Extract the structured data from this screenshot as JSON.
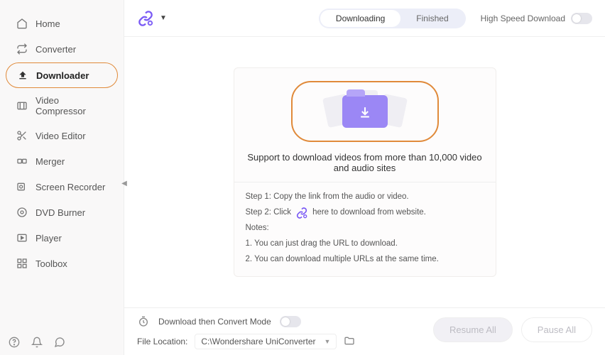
{
  "sidebar": {
    "items": [
      {
        "label": "Home"
      },
      {
        "label": "Converter"
      },
      {
        "label": "Downloader",
        "active": true
      },
      {
        "label": "Video Compressor"
      },
      {
        "label": "Video Editor"
      },
      {
        "label": "Merger"
      },
      {
        "label": "Screen Recorder"
      },
      {
        "label": "DVD Burner"
      },
      {
        "label": "Player"
      },
      {
        "label": "Toolbox"
      }
    ]
  },
  "topbar": {
    "tab_downloading": "Downloading",
    "tab_finished": "Finished",
    "high_speed_label": "High Speed Download"
  },
  "card": {
    "support_text": "Support to download videos from more than 10,000 video and audio sites",
    "step1": "Step 1: Copy the link from the audio or video.",
    "step2_pre": "Step 2: Click",
    "step2_post": "here to download from website.",
    "notes_label": "Notes:",
    "note1": "1. You can just drag the URL to download.",
    "note2": "2. You can download multiple URLs at the same time."
  },
  "bottombar": {
    "convert_mode_label": "Download then Convert Mode",
    "file_location_label": "File Location:",
    "file_location_path": "C:\\Wondershare UniConverter",
    "resume_label": "Resume All",
    "pause_label": "Pause All"
  }
}
